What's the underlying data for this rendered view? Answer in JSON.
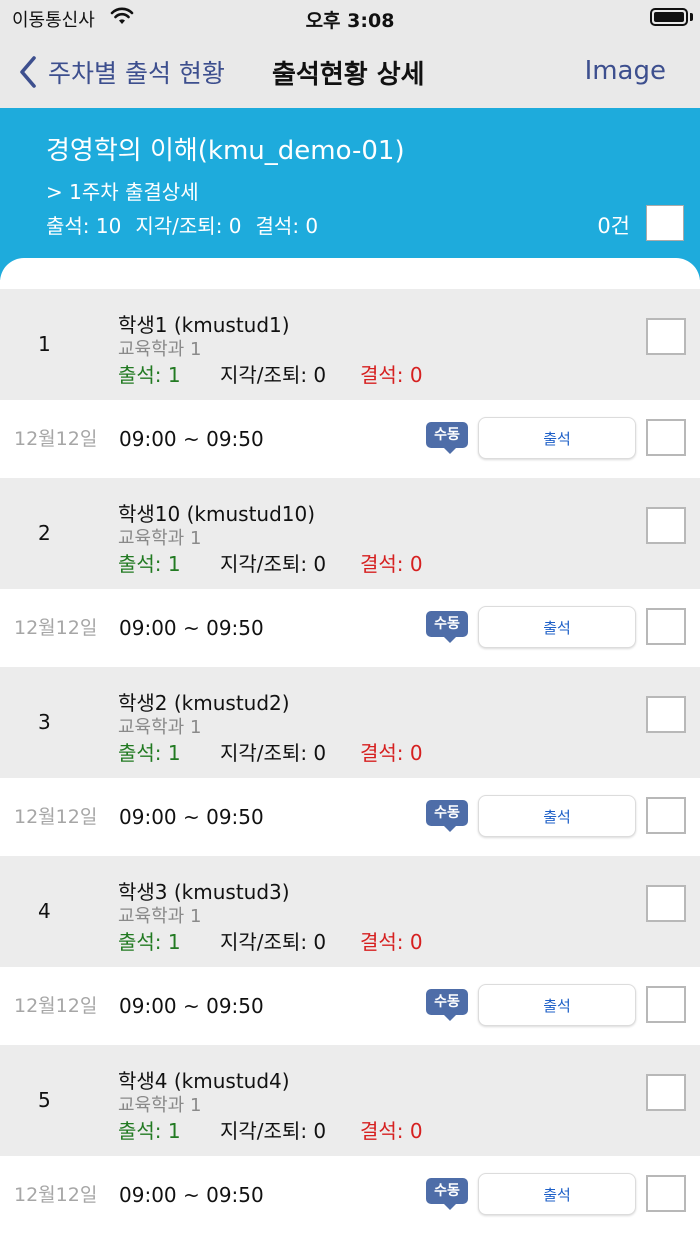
{
  "status_bar": {
    "carrier": "이동통신사",
    "time": "오후 3:08"
  },
  "nav": {
    "back_label": "주차별 출석 현황",
    "title": "출석현황 상세",
    "right_label": "Image"
  },
  "course": {
    "title": "경영학의 이해(kmu_demo-01)",
    "week_label": "> 1주차 출결상세",
    "summary_present": "출석: 10",
    "summary_late": "지각/조퇴: 0",
    "summary_absent": "결석: 0",
    "selected_count": "0건"
  },
  "colors": {
    "header_bg": "#1eabdc",
    "nav_tint": "#3d4f8e",
    "present": "#227a22",
    "absent": "#d62020",
    "badge": "#4e6da8"
  },
  "students": [
    {
      "num": "1",
      "name": "학생1 (kmustud1)",
      "dept": "교육학과 1",
      "present": "출석: 1",
      "late": "지각/조퇴: 0",
      "absent": "결석: 0",
      "session": {
        "date": "12월12일",
        "time": "09:00 ~ 09:50",
        "badge": "수동",
        "status": "출석"
      }
    },
    {
      "num": "2",
      "name": "학생10 (kmustud10)",
      "dept": "교육학과 1",
      "present": "출석: 1",
      "late": "지각/조퇴: 0",
      "absent": "결석: 0",
      "session": {
        "date": "12월12일",
        "time": "09:00 ~ 09:50",
        "badge": "수동",
        "status": "출석"
      }
    },
    {
      "num": "3",
      "name": "학생2 (kmustud2)",
      "dept": "교육학과 1",
      "present": "출석: 1",
      "late": "지각/조퇴: 0",
      "absent": "결석: 0",
      "session": {
        "date": "12월12일",
        "time": "09:00 ~ 09:50",
        "badge": "수동",
        "status": "출석"
      }
    },
    {
      "num": "4",
      "name": "학생3 (kmustud3)",
      "dept": "교육학과 1",
      "present": "출석: 1",
      "late": "지각/조퇴: 0",
      "absent": "결석: 0",
      "session": {
        "date": "12월12일",
        "time": "09:00 ~ 09:50",
        "badge": "수동",
        "status": "출석"
      }
    },
    {
      "num": "5",
      "name": "학생4 (kmustud4)",
      "dept": "교육학과 1",
      "present": "출석: 1",
      "late": "지각/조퇴: 0",
      "absent": "결석: 0",
      "session": {
        "date": "12월12일",
        "time": "09:00 ~ 09:50",
        "badge": "수동",
        "status": "출석"
      }
    }
  ]
}
